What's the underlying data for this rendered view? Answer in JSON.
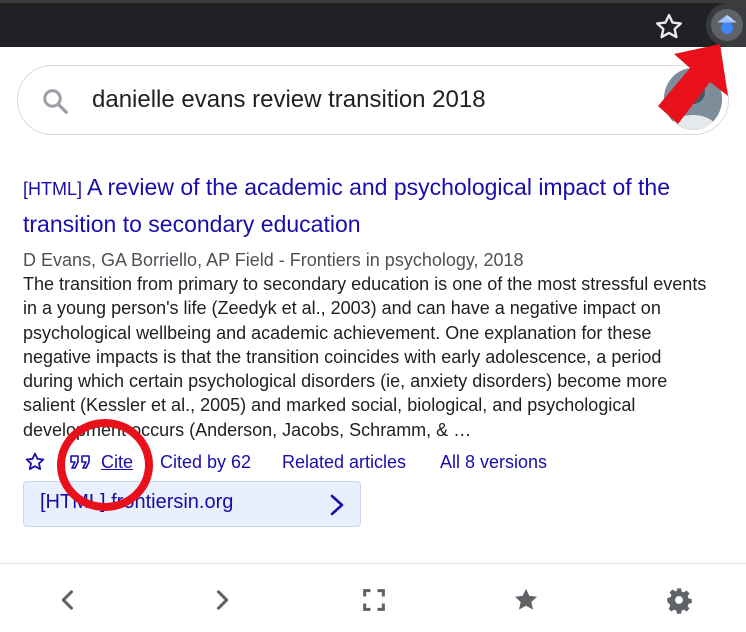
{
  "browser": {
    "bookmark_icon": "star-outline-icon",
    "extension_icon": "google-scholar-icon"
  },
  "search": {
    "query": "danielle evans review transition 2018",
    "icon": "search-icon"
  },
  "result": {
    "format_tag": "[HTML]",
    "title": "A review of the academic and psychological impact of the transition to secondary education",
    "authors": "D Evans, GA Borriello, AP Field - Frontiers in psychology, 2018",
    "snippet": "The transition from primary to secondary education is one of the most stressful events in a young person's life (Zeedyk et al., 2003) and can have a negative impact on psychological wellbeing and academic achievement. One explanation for these negative impacts is that the transition coincides with early adolescence, a period during which certain psychological disorders (ie, anxiety disorders) become more salient (Kessler et al., 2005) and marked social, biological, and psychological development occurs (Anderson, Jacobs, Schramm, & …",
    "actions": {
      "save_icon": "star-outline-icon",
      "cite_icon": "quote-icon",
      "cite": "Cite",
      "cited_by": "Cited by 62",
      "related": "Related articles",
      "versions": "All 8 versions"
    },
    "html_link": "[HTML] frontiersin.org"
  },
  "bottom_nav": [
    "back-icon",
    "forward-icon",
    "fullscreen-icon",
    "star-icon",
    "settings-icon"
  ],
  "colors": {
    "link": "#1a0dab",
    "annotation_red": "#e8101a",
    "toolbar": "#202124"
  }
}
